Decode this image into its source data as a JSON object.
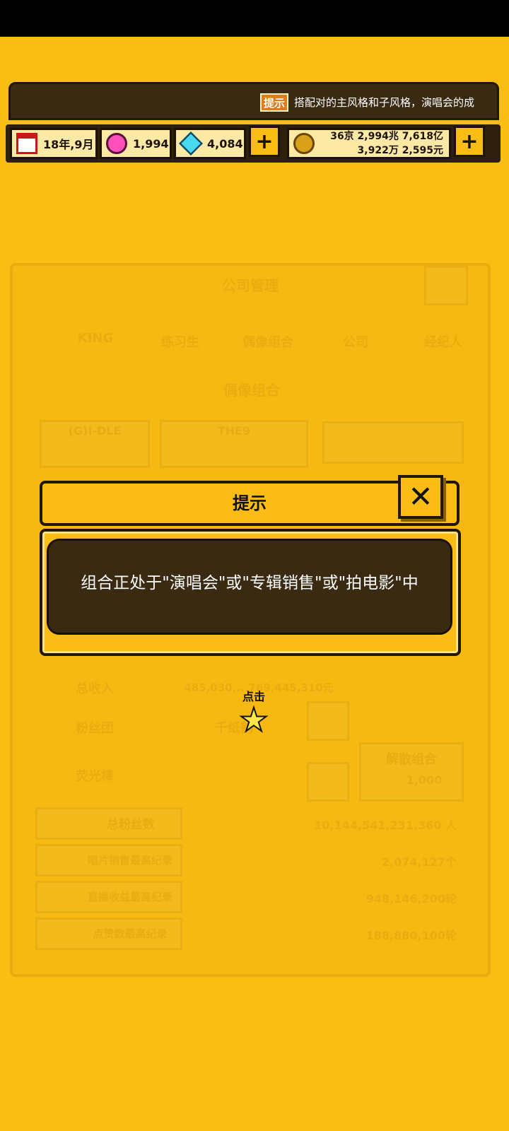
{
  "ticker": {
    "badge": "提示",
    "text": "搭配对的主风格和子风格，演唱会的成"
  },
  "resources": {
    "date": "18年,9月",
    "pink_gems": "1,994",
    "blue_gems": "4,084",
    "money_line1": "36京 2,994兆 7,618亿",
    "money_line2": "3,922万 2,595元",
    "icons": [
      "calendar-icon",
      "pink-gem-icon",
      "blue-gem-icon",
      "coin-icon"
    ]
  },
  "background": {
    "panel_title": "公司管理",
    "tabs": [
      "KING",
      "练习生",
      "偶像组合",
      "公司",
      "经纪人"
    ],
    "section_title": "偶像组合",
    "groups": [
      {
        "name": "(G)I-DLE",
        "sub": "<->"
      },
      {
        "name": "THE9",
        "sub": "<->"
      }
    ],
    "rows": [
      {
        "label": "总收入",
        "value": "485,030,...769,445,310元"
      },
      {
        "label": "粉丝团",
        "value": "千纸鹤"
      },
      {
        "label": "荧光棒",
        "value": ""
      }
    ],
    "disband": {
      "label": "解散组合",
      "cost": "1,000"
    },
    "stats": [
      {
        "label": "总粉丝数",
        "value": "10,144,541,231,360 人"
      },
      {
        "label": "唱片销售最高纪录",
        "value": "2,074,127个"
      },
      {
        "label": "直播收益最高纪录",
        "value": "948,146,200轮"
      },
      {
        "label": "点赞数最高纪录",
        "value": "188,880,100轮"
      }
    ]
  },
  "dialog": {
    "title": "提示",
    "close": "✕",
    "message": "组合正处于\"演唱会\"或\"专辑销售\"或\"拍电影\"中"
  },
  "tap_hint": {
    "label": "点击",
    "icon": "star-icon"
  }
}
